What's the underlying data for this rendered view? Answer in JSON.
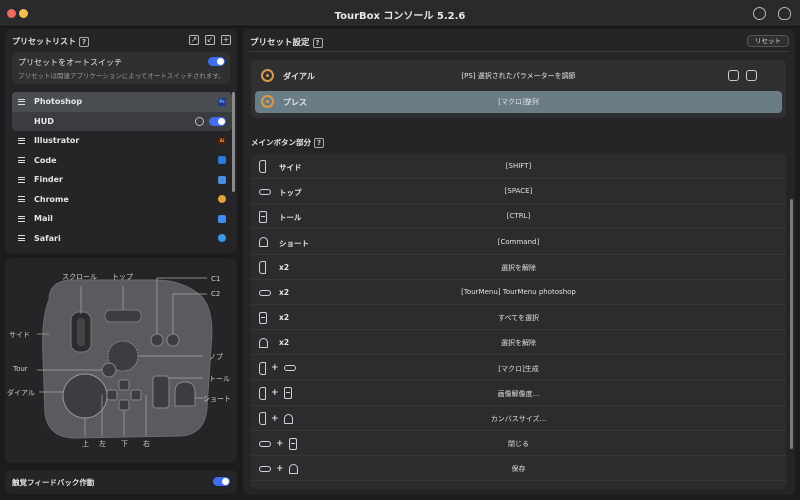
{
  "window": {
    "title": "TourBox コンソール 5.2.6"
  },
  "preset_list": {
    "header": "プリセットリスト",
    "help": "?",
    "auto_switch": {
      "title": "プリセットをオートスイッチ",
      "desc": "プリセットは関連アプリケーションによってオートスイッチされます。",
      "enabled": true
    },
    "items": [
      {
        "label": "Photoshop",
        "badge": "Ps",
        "color": "#1e3a8a"
      },
      {
        "label": "HUD"
      },
      {
        "label": "Illustrator",
        "badge": "Ai",
        "color": "#4a1e0f"
      },
      {
        "label": "Code",
        "badge": "",
        "color": "#2b7bd6"
      },
      {
        "label": "Finder",
        "badge": "",
        "color": "#4a90e2"
      },
      {
        "label": "Chrome",
        "badge": "",
        "color": "#e0a23a"
      },
      {
        "label": "Mail",
        "badge": "",
        "color": "#3d8df0"
      },
      {
        "label": "Safari",
        "badge": "",
        "color": "#3b9ae8"
      }
    ]
  },
  "device": {
    "labels": {
      "scroll": "スクロール",
      "top": "トップ",
      "c1": "C1",
      "c2": "C2",
      "side": "サイド",
      "knob": "ノブ",
      "tour": "Tour",
      "tall": "トール",
      "dial": "ダイアル",
      "short": "ショート",
      "up": "上",
      "left": "左",
      "down": "下",
      "right": "右"
    }
  },
  "haptic": {
    "label": "触覚フィードバック作動",
    "enabled": true
  },
  "preset_settings": {
    "header": "プリセット設定",
    "reset": "リセット",
    "top_rows": [
      {
        "name": "ダイアル",
        "action": "[PS] 選択されたパラメーターを調節"
      },
      {
        "name": "プレス",
        "action": "[マクロ]整列"
      }
    ],
    "main_header": "メインボタン部分",
    "main_rows": [
      {
        "icons": [
          "side"
        ],
        "name": "サイド",
        "action": "[SHIFT]"
      },
      {
        "icons": [
          "top"
        ],
        "name": "トップ",
        "action": "[SPACE]"
      },
      {
        "icons": [
          "tall"
        ],
        "name": "トール",
        "action": "[CTRL]"
      },
      {
        "icons": [
          "short"
        ],
        "name": "ショート",
        "action": "[Command]"
      },
      {
        "icons": [
          "side"
        ],
        "name": "x2",
        "action": "選択を解除"
      },
      {
        "icons": [
          "top"
        ],
        "name": "x2",
        "action": "[TourMenu] TourMenu photoshop"
      },
      {
        "icons": [
          "tall"
        ],
        "name": "x2",
        "action": "すべてを選択"
      },
      {
        "icons": [
          "short"
        ],
        "name": "x2",
        "action": "選択を解除"
      },
      {
        "icons": [
          "side",
          "top"
        ],
        "name": "",
        "action": "[マクロ]生成"
      },
      {
        "icons": [
          "side",
          "tall"
        ],
        "name": "",
        "action": "画像解像度..."
      },
      {
        "icons": [
          "side",
          "short"
        ],
        "name": "",
        "action": "カンバスサイズ..."
      },
      {
        "icons": [
          "top",
          "tall"
        ],
        "name": "",
        "action": "閉じる"
      },
      {
        "icons": [
          "top",
          "short"
        ],
        "name": "",
        "action": "保存"
      }
    ]
  }
}
